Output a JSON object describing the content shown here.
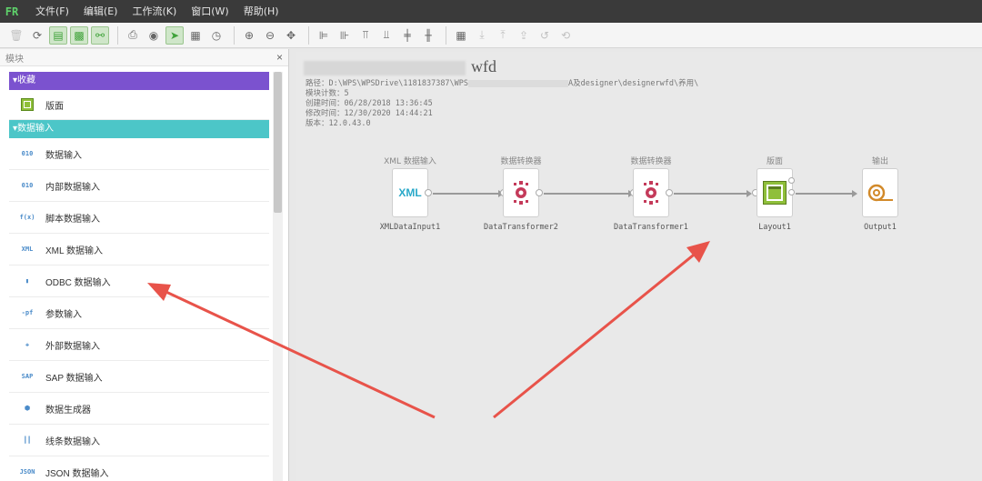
{
  "menubar": {
    "logo": "FR",
    "items": [
      "文件(F)",
      "编辑(E)",
      "工作流(K)",
      "窗口(W)",
      "帮助(H)"
    ]
  },
  "toolbar": {
    "icons": [
      "delete-icon",
      "refresh-icon",
      "module-view-icon",
      "image-view-icon",
      "link-view-icon",
      "print-icon",
      "preview-icon",
      "select-pointer-icon",
      "grid-icon",
      "clock-icon",
      "zoom-in-icon",
      "zoom-out-icon",
      "move-icon",
      "align-left-icon",
      "align-right-icon",
      "align-top-icon",
      "align-bottom-icon",
      "align-center-h-icon",
      "align-center-v-icon",
      "table-icon",
      "download-icon",
      "upload-icon",
      "upload-alt-icon",
      "undo-icon",
      "history-icon"
    ]
  },
  "panel": {
    "title": "模块",
    "close": "×",
    "sections": {
      "favorites": "▾收藏",
      "data_input": "▾数据输入"
    },
    "favorite_items": [
      {
        "label": "版面",
        "icon": "layout-icon"
      }
    ],
    "input_items": [
      {
        "label": "数据输入",
        "icon": "data-input-icon",
        "glyph": "010"
      },
      {
        "label": "内部数据输入",
        "icon": "internal-data-icon",
        "glyph": "010"
      },
      {
        "label": "脚本数据输入",
        "icon": "script-data-icon",
        "glyph": "f(x)"
      },
      {
        "label": "XML 数据输入",
        "icon": "xml-data-icon",
        "glyph": "XML"
      },
      {
        "label": "ODBC 数据输入",
        "icon": "odbc-data-icon",
        "glyph": "▮"
      },
      {
        "label": "参数输入",
        "icon": "param-input-icon",
        "glyph": "-pf"
      },
      {
        "label": "外部数据输入",
        "icon": "external-data-icon",
        "glyph": "✚"
      },
      {
        "label": "SAP 数据输入",
        "icon": "sap-data-icon",
        "glyph": "SAP"
      },
      {
        "label": "数据生成器",
        "icon": "data-generator-icon",
        "glyph": "⬢"
      },
      {
        "label": "线条数据输入",
        "icon": "line-data-icon",
        "glyph": "┃┃"
      },
      {
        "label": "JSON 数据输入",
        "icon": "json-data-icon",
        "glyph": "JSON"
      }
    ]
  },
  "document": {
    "title_suffix": "wfd",
    "meta": {
      "path_prefix": "路径：D:\\WPS\\WPSDrive\\1181837387\\WPS",
      "path_suffix": "A及designer\\designerwfd\\养用\\",
      "module_count": "模块计数：5",
      "created": "创建时间：06/28/2018 13:36:45",
      "modified": "修改时间：12/30/2020 14:44:21",
      "version": "版本：12.0.43.0"
    }
  },
  "workflow": {
    "nodes": [
      {
        "top_label": "XML 数据输入",
        "bottom_label": "XMLDataInput1",
        "icon": "xml-node-icon",
        "glyph": "XML"
      },
      {
        "top_label": "数据转换器",
        "bottom_label": "DataTransformer2",
        "icon": "transformer-icon",
        "glyph": "⚙"
      },
      {
        "top_label": "数据转换器",
        "bottom_label": "DataTransformer1",
        "icon": "transformer-icon",
        "glyph": "⚙"
      },
      {
        "top_label": "版面",
        "bottom_label": "Layout1",
        "icon": "layout-node-icon",
        "glyph": "▣"
      },
      {
        "top_label": "输出",
        "bottom_label": "Output1",
        "icon": "output-icon",
        "glyph": "◎"
      }
    ]
  },
  "colors": {
    "favorites": "#7b52cf",
    "data_input": "#4cc6c8",
    "annotation_arrow": "#e8534a"
  }
}
